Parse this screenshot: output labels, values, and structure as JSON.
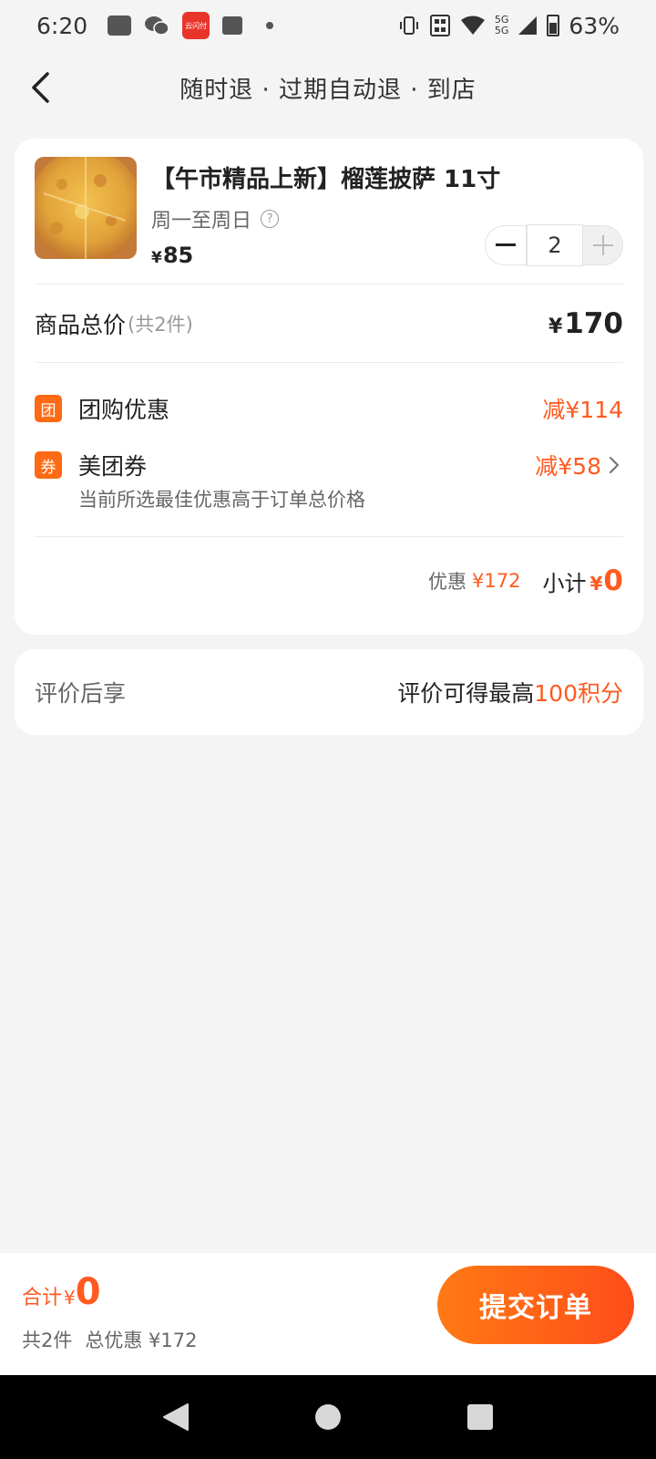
{
  "status_bar": {
    "time": "6:20",
    "app_badge": "云闪付",
    "network": [
      "5G",
      "5G"
    ],
    "battery": "63%"
  },
  "nav": {
    "title": "随时退 · 过期自动退 · 到店"
  },
  "product": {
    "name": "【午市精品上新】榴莲披萨 11寸",
    "days": "周一至周日",
    "help": "?",
    "currency": "¥",
    "price": "85",
    "quantity": "2"
  },
  "total": {
    "label": "商品总价",
    "count": "(共2件)",
    "currency": "¥",
    "amount": "170"
  },
  "discounts": [
    {
      "badge": "团",
      "label": "团购优惠",
      "amount": "减¥114"
    },
    {
      "badge": "券",
      "label": "美团券",
      "amount": "减¥58",
      "note": "当前所选最佳优惠高于订单总价格"
    }
  ],
  "summary": {
    "saving_label": "优惠",
    "saving": "¥172",
    "subtotal_label": "小计",
    "currency": "¥",
    "subtotal": "0"
  },
  "review": {
    "label": "评价后享",
    "text": "评价可得最高",
    "points": "100积分"
  },
  "bottom_bar": {
    "total_label": "合计",
    "currency": "¥",
    "total": "0",
    "count": "共2件",
    "total_saving": "总优惠 ¥172",
    "submit": "提交订单"
  },
  "colors": {
    "accent": "#ff5a1f",
    "button_gradient_start": "#ff7a14",
    "button_gradient_end": "#ff4d1a",
    "background": "#f4f4f4"
  }
}
